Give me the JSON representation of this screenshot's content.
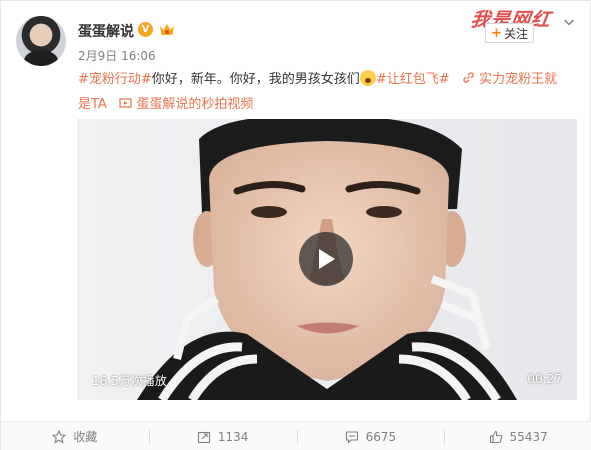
{
  "user": {
    "name": "蛋蛋解说",
    "verified_badge": "V",
    "post_time": "2月9日 16:06"
  },
  "watermark_text": "我是网红",
  "follow_button": {
    "label": "关注"
  },
  "post": {
    "tag1": "#宠粉行动#",
    "text1": "你好，新年。你好，我的男孩女孩们",
    "tag2": "#让红包飞#",
    "link1_label": "实力宠粉王就是TA",
    "link2_label": "蛋蛋解说的秒拍视频"
  },
  "video": {
    "view_count": "16.5万次播放",
    "duration": "00:27"
  },
  "actions": {
    "favorite_label": "收藏",
    "repost_count": "1134",
    "comment_count": "6675",
    "like_count": "55437"
  },
  "colors": {
    "accent": "#eb7350",
    "follow_plus": "#ff8200",
    "watermark": "#e23b3b"
  }
}
